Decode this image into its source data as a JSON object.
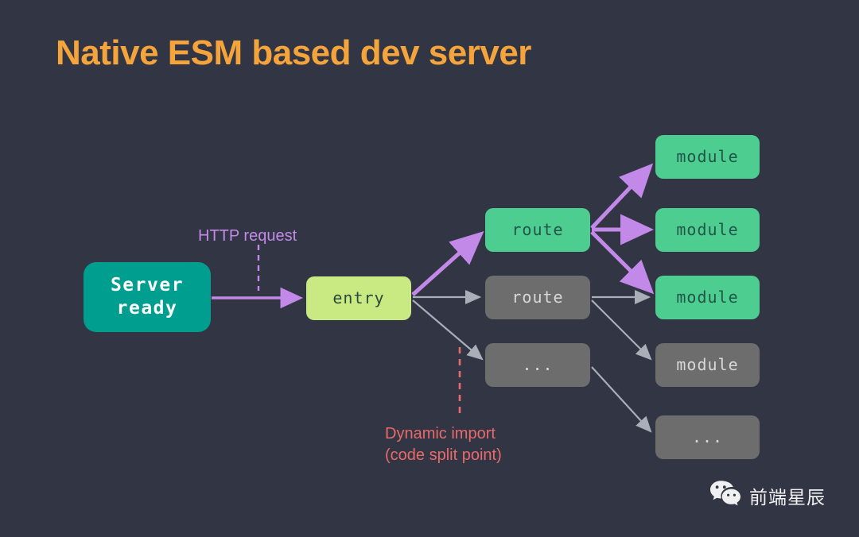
{
  "slide": {
    "title": "Native ESM based dev server",
    "background_color": "#323644",
    "title_color": "#F5A43C"
  },
  "colors": {
    "purple_arrow": "#C389E8",
    "gray_arrow": "#A9AEB8",
    "dynamic_import_red": "#E96A6A",
    "server_teal": "#009E8E",
    "entry_green": "#C9E982",
    "module_green": "#4ECD91",
    "inactive_gray": "#6D6D6D"
  },
  "nodes": [
    {
      "id": "server",
      "label": "Server\nready",
      "style": "teal"
    },
    {
      "id": "entry",
      "label": "entry",
      "style": "light-green"
    },
    {
      "id": "route1",
      "label": "route",
      "style": "green"
    },
    {
      "id": "route2",
      "label": "route",
      "style": "gray"
    },
    {
      "id": "route3",
      "label": "...",
      "style": "gray"
    },
    {
      "id": "module1",
      "label": "module",
      "style": "green"
    },
    {
      "id": "module2",
      "label": "module",
      "style": "green"
    },
    {
      "id": "module3",
      "label": "module",
      "style": "green"
    },
    {
      "id": "module4",
      "label": "module",
      "style": "gray"
    },
    {
      "id": "module5",
      "label": "...",
      "style": "gray"
    }
  ],
  "labels": {
    "http_request": "HTTP request",
    "dynamic_import": "Dynamic import\n(code split point)"
  },
  "branding": {
    "wechat_name": "前端星辰",
    "wechat_icon": "wechat-icon"
  }
}
